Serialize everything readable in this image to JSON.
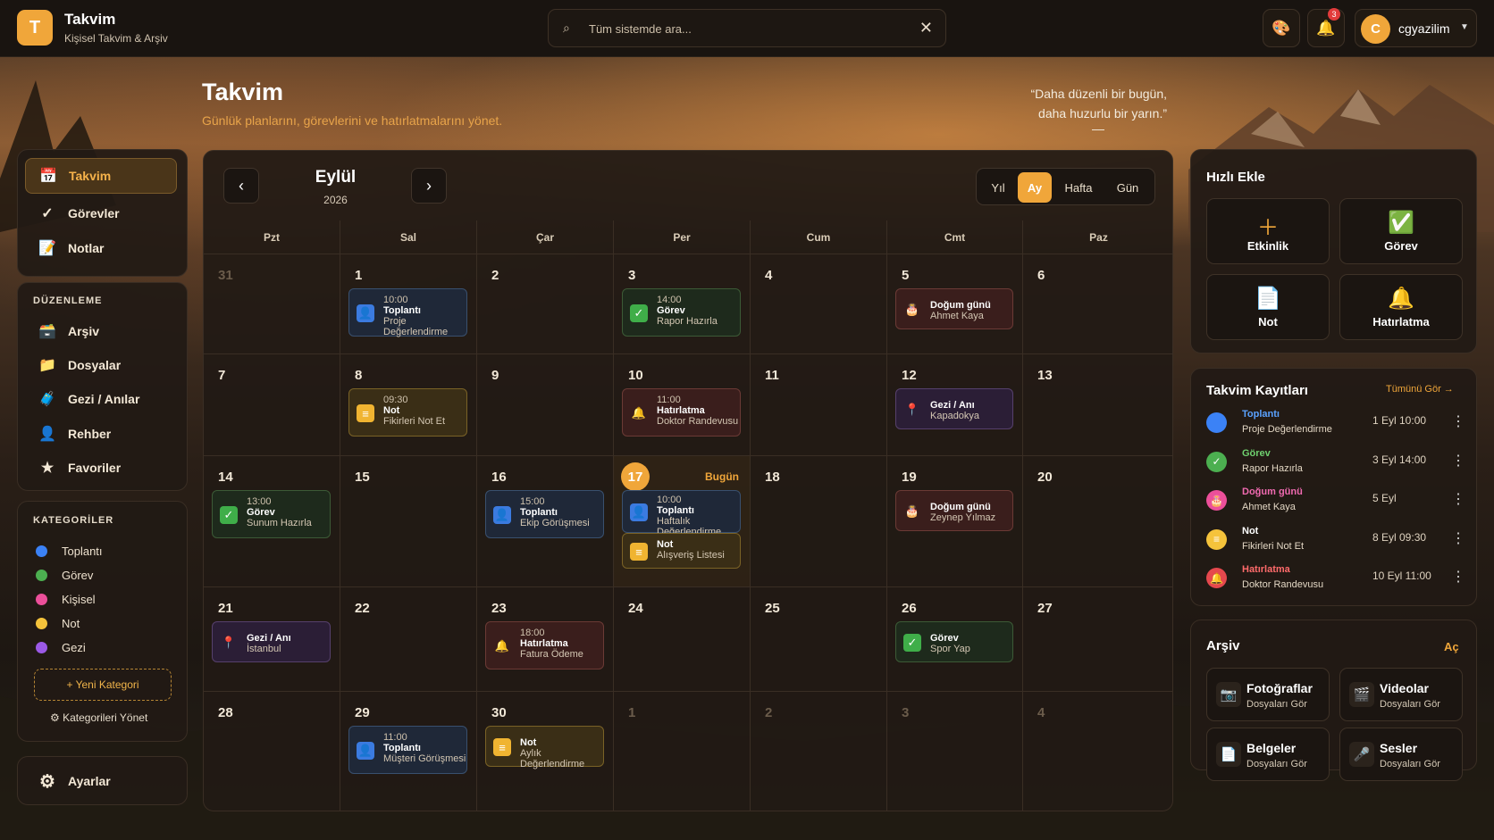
{
  "app": {
    "logo_letter": "T",
    "title": "Takvim",
    "subtitle": "Kişisel Takvim & Arşiv"
  },
  "search": {
    "placeholder": "Tüm sistemde ara..."
  },
  "notifications": {
    "count": "3"
  },
  "user": {
    "initial": "C",
    "name": "cgyazilim"
  },
  "page": {
    "title": "Takvim",
    "subtitle": "Günlük planlarını, görevlerini ve hatırlatmalarını yönet.",
    "quote_line1": "“Daha düzenli bir bugün,",
    "quote_line2": "daha huzurlu bir yarın.”",
    "quote_dash": "—"
  },
  "nav": [
    {
      "label": "Takvim",
      "icon": "calendar-icon"
    },
    {
      "label": "Görevler",
      "icon": "check-icon"
    },
    {
      "label": "Notlar",
      "icon": "memo-icon"
    }
  ],
  "edit": {
    "heading": "DÜZENLEME",
    "items": [
      {
        "label": "Arşiv",
        "icon": "archive-icon"
      },
      {
        "label": "Dosyalar",
        "icon": "folder-icon"
      },
      {
        "label": "Gezi / Anılar",
        "icon": "luggage-icon"
      },
      {
        "label": "Rehber",
        "icon": "person-icon"
      },
      {
        "label": "Favoriler",
        "icon": "star-icon"
      }
    ]
  },
  "categories": {
    "heading": "KATEGORİLER",
    "items": [
      {
        "label": "Toplantı",
        "color": "#3b82f6"
      },
      {
        "label": "Görev",
        "color": "#4caf50"
      },
      {
        "label": "Kişisel",
        "color": "#ec4f9a"
      },
      {
        "label": "Not",
        "color": "#f5c33b"
      },
      {
        "label": "Gezi",
        "color": "#9b59e6"
      }
    ],
    "new": "+ Yeni Kategori",
    "manage": "Kategorileri Yönet"
  },
  "settings": {
    "label": "Ayarlar"
  },
  "calendar": {
    "month": "Eylül",
    "year": "2026",
    "views": [
      "Yıl",
      "Ay",
      "Hafta",
      "Gün"
    ],
    "active_view": "Ay",
    "today_label": "Bugün",
    "weekdays": [
      "Pzt",
      "Sal",
      "Çar",
      "Per",
      "Cum",
      "Cmt",
      "Paz"
    ],
    "weeks": [
      [
        {
          "d": "31",
          "dim": true
        },
        {
          "d": "1"
        },
        {
          "d": "2"
        },
        {
          "d": "3"
        },
        {
          "d": "4"
        },
        {
          "d": "5"
        },
        {
          "d": "6"
        }
      ],
      [
        {
          "d": "7"
        },
        {
          "d": "8"
        },
        {
          "d": "9"
        },
        {
          "d": "10"
        },
        {
          "d": "11"
        },
        {
          "d": "12"
        },
        {
          "d": "13"
        }
      ],
      [
        {
          "d": "14"
        },
        {
          "d": "15"
        },
        {
          "d": "16"
        },
        {
          "d": "17",
          "today": true
        },
        {
          "d": "18"
        },
        {
          "d": "19"
        },
        {
          "d": "20"
        }
      ],
      [
        {
          "d": "21"
        },
        {
          "d": "22"
        },
        {
          "d": "23"
        },
        {
          "d": "24"
        },
        {
          "d": "25"
        },
        {
          "d": "26"
        },
        {
          "d": "27"
        }
      ],
      [
        {
          "d": "28"
        },
        {
          "d": "29"
        },
        {
          "d": "30"
        },
        {
          "d": "1",
          "dim": true
        },
        {
          "d": "2",
          "dim": true
        },
        {
          "d": "3",
          "dim": true
        },
        {
          "d": "4",
          "dim": true
        }
      ]
    ],
    "events": [
      {
        "w": 0,
        "c": 1,
        "slot": 0,
        "type": "blue",
        "icon": "person-icon",
        "time": "10:00",
        "name": "Toplantı",
        "sub": "Proje Değerlendirme"
      },
      {
        "w": 0,
        "c": 3,
        "slot": 0,
        "type": "green",
        "icon": "check-icon",
        "time": "14:00",
        "name": "Görev",
        "sub": "Rapor Hazırla"
      },
      {
        "w": 0,
        "c": 5,
        "slot": 0,
        "type": "red",
        "icon": "cake-icon",
        "time": "",
        "name": "Doğum günü",
        "sub": "Ahmet Kaya"
      },
      {
        "w": 1,
        "c": 1,
        "slot": 0,
        "type": "yel",
        "icon": "note-icon",
        "time": "09:30",
        "name": "Not",
        "sub": "Fikirleri Not Et"
      },
      {
        "w": 1,
        "c": 3,
        "slot": 0,
        "type": "red",
        "icon": "bell-icon",
        "time": "11:00",
        "name": "Hatırlatma",
        "sub": "Doktor Randevusu"
      },
      {
        "w": 1,
        "c": 5,
        "slot": 0,
        "type": "pur",
        "icon": "pin-icon",
        "time": "",
        "name": "Gezi / Anı",
        "sub": "Kapadokya"
      },
      {
        "w": 2,
        "c": 0,
        "slot": 0,
        "type": "green",
        "icon": "check-icon",
        "time": "13:00",
        "name": "Görev",
        "sub": "Sunum Hazırla"
      },
      {
        "w": 2,
        "c": 2,
        "slot": 0,
        "type": "blue",
        "icon": "person-icon",
        "time": "15:00",
        "name": "Toplantı",
        "sub": "Ekip Görüşmesi"
      },
      {
        "w": 2,
        "c": 3,
        "slot": 1,
        "type": "blue",
        "icon": "person-icon",
        "time": "10:00",
        "name": "Toplantı",
        "sub": "Haftalık Değerlendirme"
      },
      {
        "w": 2,
        "c": 3,
        "slot": 2,
        "type": "yel",
        "icon": "note-icon",
        "time": "",
        "name": "Not",
        "sub": "Alışveriş Listesi"
      },
      {
        "w": 2,
        "c": 5,
        "slot": 0,
        "type": "red",
        "icon": "cake-icon",
        "time": "",
        "name": "Doğum günü",
        "sub": "Zeynep Yılmaz"
      },
      {
        "w": 3,
        "c": 0,
        "slot": 0,
        "type": "pur",
        "icon": "pin-icon",
        "time": "",
        "name": "Gezi / Anı",
        "sub": "İstanbul"
      },
      {
        "w": 3,
        "c": 2,
        "slot": 0,
        "type": "red",
        "icon": "bell-icon",
        "time": "18:00",
        "name": "Hatırlatma",
        "sub": "Fatura Ödeme"
      },
      {
        "w": 3,
        "c": 5,
        "slot": 0,
        "type": "green",
        "icon": "check-icon",
        "time": "",
        "name": "Görev",
        "sub": "Spor Yap"
      },
      {
        "w": 4,
        "c": 1,
        "slot": 0,
        "type": "blue",
        "icon": "person-icon",
        "time": "11:00",
        "name": "Toplantı",
        "sub": "Müşteri Görüşmesi"
      },
      {
        "w": 4,
        "c": 2,
        "slot": 0,
        "type": "yel",
        "icon": "note-icon",
        "time": "",
        "name": "Not",
        "sub": "Aylık Değerlendirme"
      }
    ]
  },
  "quick": {
    "title": "Hızlı Ekle",
    "items": [
      {
        "label": "Etkinlik",
        "icon": "plus-icon"
      },
      {
        "label": "Görev",
        "icon": "check-icon"
      },
      {
        "label": "Not",
        "icon": "document-icon"
      },
      {
        "label": "Hatırlatma",
        "icon": "bell-icon"
      }
    ]
  },
  "records": {
    "title": "Takvim Kayıtları",
    "see_all": "Tümünü Gör →",
    "items": [
      {
        "type": "Toplantı",
        "sub": "Proje Değerlendirme",
        "date": "1 Eyl 10:00",
        "color": "#3b82f6",
        "type_color": "#5aa2ff"
      },
      {
        "type": "Görev",
        "sub": "Rapor Hazırla",
        "date": "3 Eyl 14:00",
        "color": "#4caf50",
        "type_color": "#6fd06f"
      },
      {
        "type": "Doğum günü",
        "sub": "Ahmet Kaya",
        "date": "5 Eyl",
        "color": "#ec4f9a",
        "type_color": "#f06ab0"
      },
      {
        "type": "Not",
        "sub": "Fikirleri Not Et",
        "date": "8 Eyl 09:30",
        "color": "#f5c33b",
        "type_color": "#ffffff"
      },
      {
        "type": "Hatırlatma",
        "sub": "Doktor Randevusu",
        "date": "10 Eyl 11:00",
        "color": "#e5484d",
        "type_color": "#ff6b6b"
      }
    ]
  },
  "archive": {
    "title": "Arşiv",
    "open": "Aç",
    "items": [
      {
        "title": "Fotoğraflar",
        "sub": "Dosyaları Gör",
        "icon": "camera-icon"
      },
      {
        "title": "Videolar",
        "sub": "Dosyaları Gör",
        "icon": "film-icon"
      },
      {
        "title": "Belgeler",
        "sub": "Dosyaları Gör",
        "icon": "document-icon"
      },
      {
        "title": "Sesler",
        "sub": "Dosyaları Gör",
        "icon": "microphone-icon"
      }
    ]
  }
}
